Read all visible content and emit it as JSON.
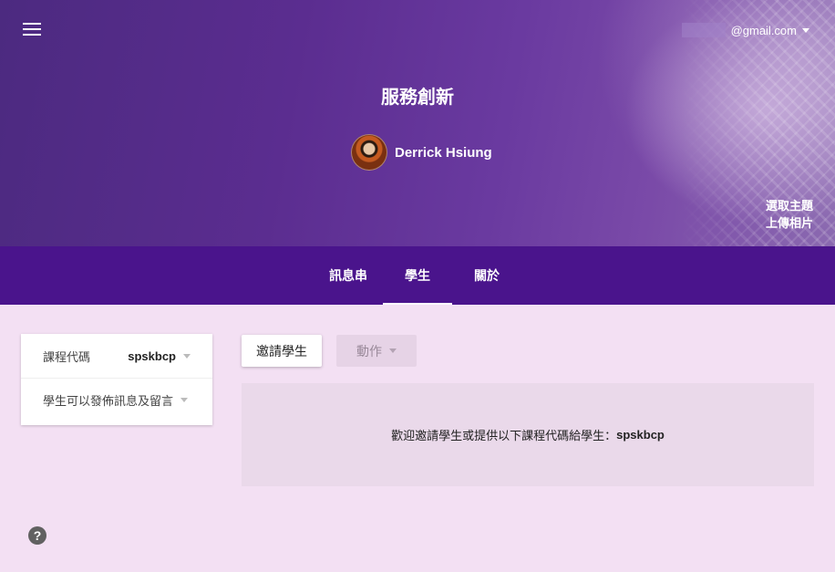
{
  "header": {
    "account_email": "@gmail.com",
    "course_title": "服務創新",
    "teacher_name": "Derrick Hsiung",
    "links": {
      "choose_theme": "選取主題",
      "upload_photo": "上傳相片"
    }
  },
  "tabs": [
    {
      "label": "訊息串",
      "active": false
    },
    {
      "label": "學生",
      "active": true
    },
    {
      "label": "關於",
      "active": false
    }
  ],
  "info_card": {
    "course_code_label": "課程代碼",
    "course_code_value": "spskbcp",
    "student_permission_label": "學生可以發佈訊息及留言"
  },
  "buttons": {
    "invite": "邀請學生",
    "actions": "動作"
  },
  "empty_state": {
    "message": "歡迎邀請學生或提供以下課程代碼給學生：",
    "code": "spskbcp"
  },
  "help": {
    "glyph": "?"
  },
  "colors": {
    "tabbar": "#4a148c",
    "page_background": "#f3e0f3",
    "panel_background": "#ead9ea"
  }
}
